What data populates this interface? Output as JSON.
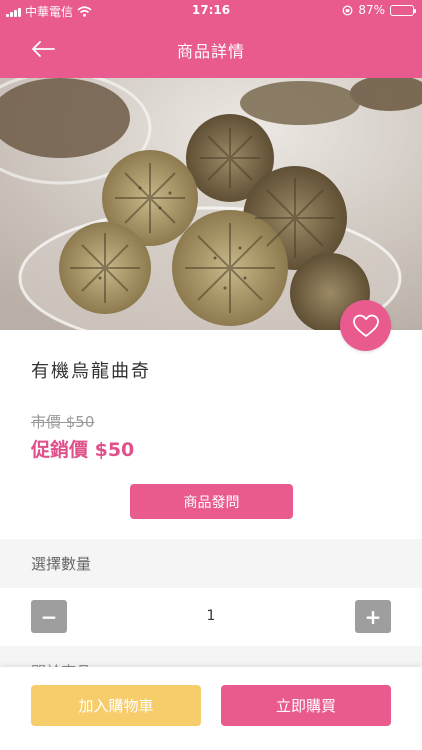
{
  "status_bar": {
    "carrier": "中華電信",
    "time": "17:16",
    "battery": "87%",
    "battery_level": 0.87
  },
  "nav": {
    "title": "商品詳情",
    "back_icon": "arrow-left-icon"
  },
  "product": {
    "name": "有機烏龍曲奇",
    "market_price": "市價 $50",
    "promo_price": "促銷價 $50",
    "favorite_icon": "heart-icon"
  },
  "actions": {
    "ask_label": "商品發問",
    "add_to_cart_label": "加入購物車",
    "buy_now_label": "立即購買"
  },
  "quantity": {
    "label": "選擇數量",
    "value": "1",
    "minus": "−",
    "plus": "+"
  },
  "related": {
    "label": "關於商品"
  },
  "colors": {
    "brand_pink": "#e95a8e",
    "price_pink": "#e0508a",
    "cart_yellow": "#f7cc6b",
    "stepper_gray": "#9e9e9e"
  }
}
